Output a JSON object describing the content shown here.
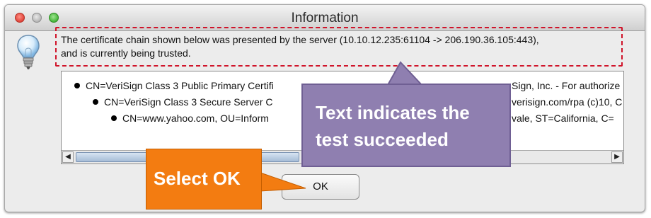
{
  "window": {
    "title": "Information"
  },
  "message": {
    "line1": "The certificate chain shown below was presented by the server (10.10.12.235:61104 -> 206.190.36.105:443),",
    "line2": "and is currently being trusted."
  },
  "tree": {
    "rows": [
      "CN=VeriSign Class 3 Public Primary Certifi",
      "CN=VeriSign Class 3 Secure Server C",
      "CN=www.yahoo.com, OU=Inform"
    ],
    "right_fragments": [
      "Sign, Inc. - For authorize",
      "verisign.com/rpa (c)10, C",
      "vale, ST=California, C="
    ]
  },
  "scrollbar": {
    "left_arrow": "◀",
    "right_arrow": "▶"
  },
  "buttons": {
    "ok_label": "OK"
  },
  "callouts": {
    "purple_line1": "Text indicates the",
    "purple_line2": "test succeeded",
    "orange": "Select OK"
  },
  "colors": {
    "callout_purple": "#8f7fb0",
    "callout_orange": "#f37c11",
    "highlight_border": "#d0142a"
  }
}
